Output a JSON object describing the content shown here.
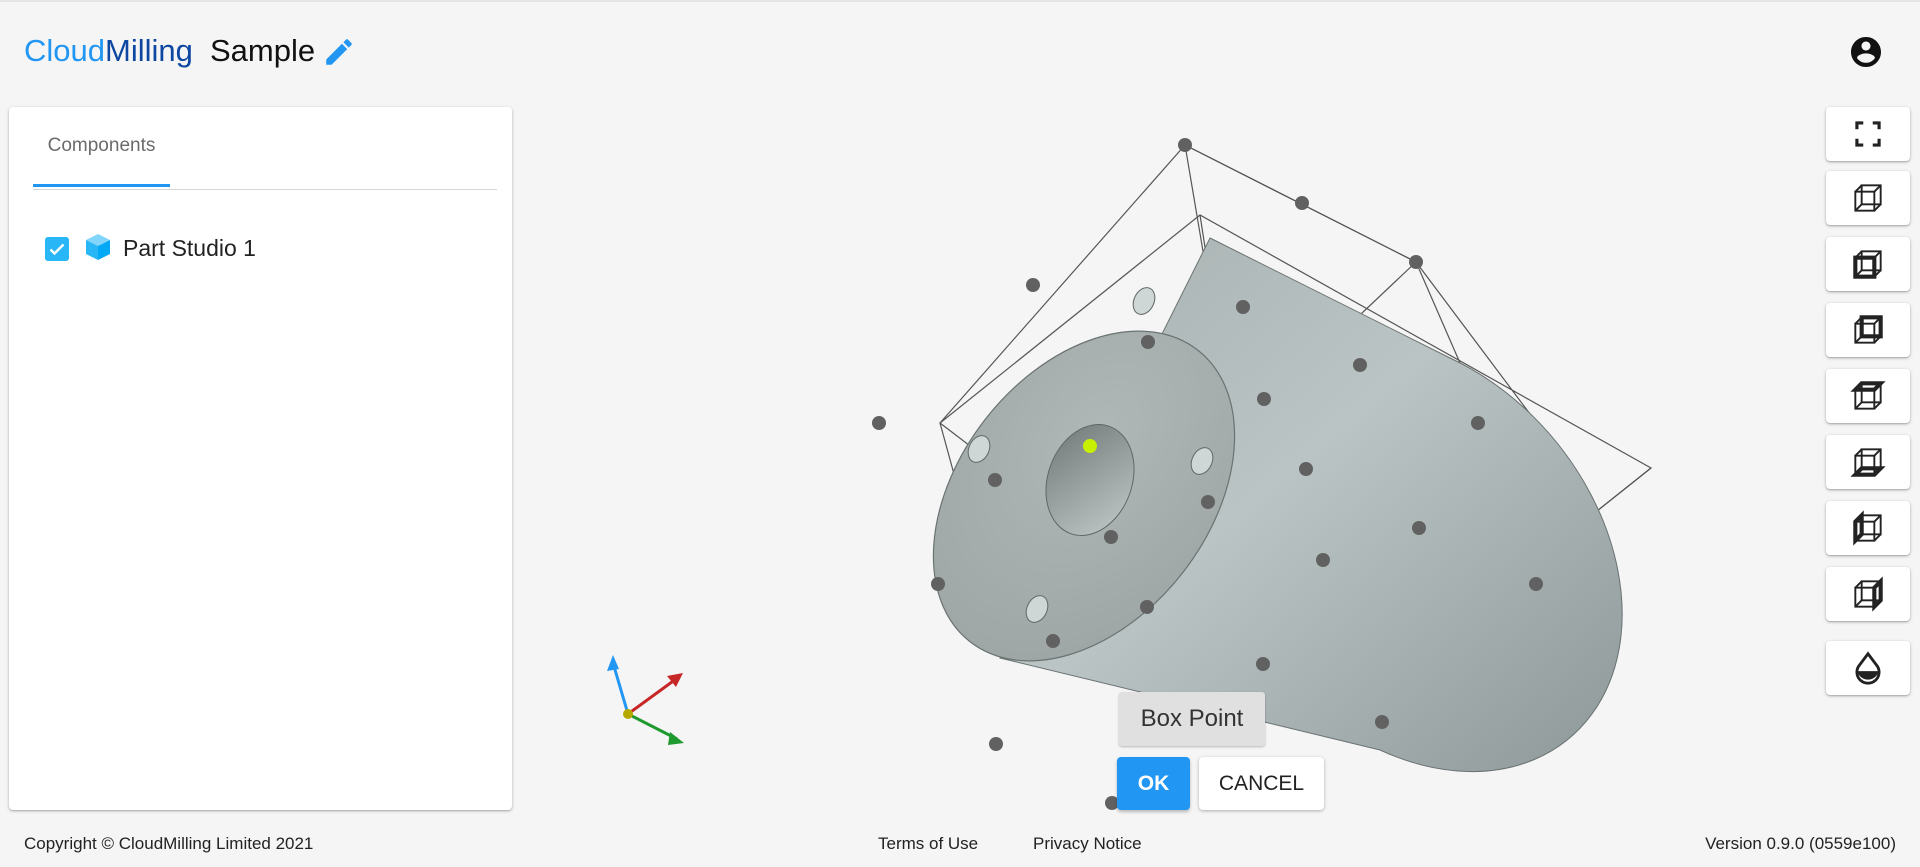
{
  "header": {
    "brand_part1": "Cloud",
    "brand_part2": "Milling",
    "project_title": "Sample",
    "edit_icon": "pencil-icon",
    "account_icon": "account-circle-icon"
  },
  "panel": {
    "tab_label": "Components",
    "items": [
      {
        "label": "Part Studio 1",
        "checked": true,
        "icon": "cube-icon"
      }
    ]
  },
  "toolbar": {
    "icons": [
      "fullscreen-icon",
      "view-cube-icon",
      "view-cube-front-icon",
      "view-cube-back-icon",
      "view-cube-top-icon",
      "view-cube-bottom-icon",
      "view-cube-left-icon",
      "view-cube-right-icon",
      "material-drop-icon"
    ]
  },
  "viewport": {
    "tooltip_label": "Box Point",
    "ok_label": "OK",
    "cancel_label": "CANCEL",
    "axis_colors": {
      "x": "#c62828",
      "y": "#1e9a2e",
      "z": "#2196f3"
    },
    "highlight_color": "#c6f000"
  },
  "colors": {
    "accent": "#2196f3",
    "brand_dark": "#0d47a1",
    "checkbox": "#29b6f6"
  },
  "footer": {
    "copyright": "Copyright © CloudMilling Limited 2021",
    "terms": "Terms of Use",
    "privacy": "Privacy Notice",
    "version": "Version 0.9.0 (0559e100)"
  }
}
